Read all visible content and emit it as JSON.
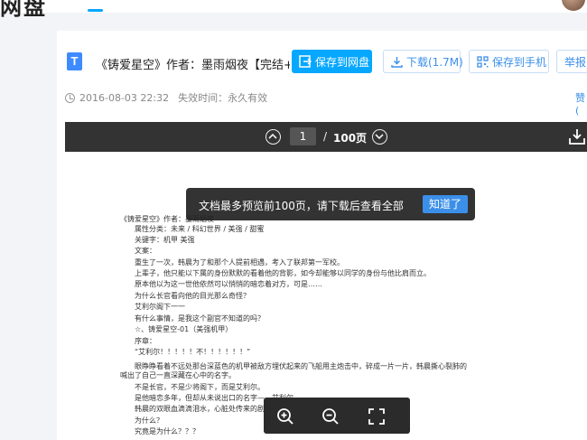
{
  "nav": {
    "logo_fragment": "网盘"
  },
  "file": {
    "icon_letter": "T",
    "title": "《铸爱星空》作者：墨雨烟夜【完结+番外...",
    "save_label": "保存到网盘",
    "download_label": "下载(1.7M)",
    "phone_label": "保存到手机",
    "report_label": "举报",
    "date": "2016-08-03 22:32",
    "expire": "失效时间：永久有效",
    "thanks": "赞("
  },
  "preview": {
    "current_page": "1",
    "separator": "/",
    "total_pages": "100页"
  },
  "toast": {
    "message": "文档最多预览前100页，请下载后查看全部",
    "ok_label": "知道了"
  },
  "doc": {
    "lines": [
      "《铸爱星空》作者：墨雨烟夜",
      "属性分类：未来 / 科幻世界 / 美强 / 甜蜜",
      "关键字：机甲      美强",
      "文案：",
      "重生了一次，韩晨为了和那个人提前相遇，考入了联邦第一军校。",
      "上辈子，他只能以下属的身份默默的看着他的背影，如今却能够以同学的身份与他比肩而立。",
      "原本他以为这一世他依然可以悄悄的暗恋着对方，可是……",
      "为什么长官看向他的目光那么奇怪？",
      "艾利尔阁下一一",
      "有什么事情，是我这个副官不知道的吗？",
      "☆、铸爱星空-01（美强机甲）",
      "序章：",
      "“艾利尔！！！！！不！！！！！！”",
      "眼睁睁看着不远处那台深蓝色的机甲被敌方埋伏起来的飞船用主炮击中，碎成一片一片，韩晨撕心裂肺的",
      "喊出了自己一直深藏在心中的名字。",
      "不是长官，不是少将阁下，而是艾利尔。",
      "是他暗恋多年，但却从未说出口的名字——艾利尔。",
      "韩晨的双眼血滴滴泪水，心脏处传来的剧痛几乎让他无法呼吸……",
      "为什么？",
      "究竟是为什么？？？"
    ]
  },
  "colors": {
    "accent": "#06a7ff",
    "link": "#3b8fe8",
    "dark_bar": "#333333",
    "toast_bg": "#222222"
  },
  "icons": [
    "file-txt-icon",
    "save-cloud-icon",
    "download-icon",
    "phone-qr-icon",
    "clock-icon",
    "page-up-icon",
    "page-down-icon",
    "download-tray-icon",
    "zoom-in-icon",
    "zoom-out-icon",
    "fullscreen-icon"
  ]
}
